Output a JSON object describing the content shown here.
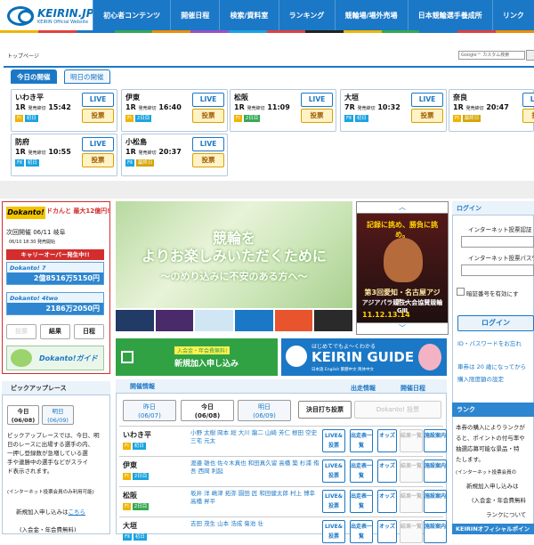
{
  "header": {
    "logo_text": "KEIRIN.JP",
    "logo_sub": "KEIRIN Official Website",
    "nav": [
      "初心者コンテンツ",
      "開催日程",
      "検索/資料室",
      "ランキング",
      "競輪場/場外売場",
      "日本競輪選手養成所",
      "リンク"
    ],
    "stripe_colors": [
      "#f0b400",
      "#e04040",
      "#1b78c6",
      "#33a852",
      "#f08c00",
      "#9b4fc6",
      "#1aa3e0",
      "#e04040",
      "#222222",
      "#f0b400",
      "#33a852",
      "#1b78c6",
      "#e04040",
      "#f08c00"
    ]
  },
  "breadcrumb": "トップページ",
  "search": {
    "placeholder": "Google™ カスタム検索"
  },
  "today_tabs": {
    "today": "今日の開催",
    "tomorrow": "明日の開催"
  },
  "today_cards": [
    {
      "venue": "いわき平",
      "race": "1R",
      "label": "発売締切",
      "time": "15:42",
      "grades": [
        {
          "t": "FⅠ",
          "c": "g1"
        },
        {
          "t": "初日",
          "c": "g2"
        }
      ],
      "live": "LIVE",
      "vote": "投票"
    },
    {
      "venue": "伊東",
      "race": "1R",
      "label": "発売締切",
      "time": "16:40",
      "grades": [
        {
          "t": "FⅠ",
          "c": "g1"
        },
        {
          "t": "2日目",
          "c": "g2"
        }
      ],
      "live": "LIVE",
      "vote": "投票"
    },
    {
      "venue": "松阪",
      "race": "1R",
      "label": "発売締切",
      "time": "11:09",
      "grades": [
        {
          "t": "FⅠ",
          "c": "g1"
        },
        {
          "t": "2日目",
          "c": "g3"
        }
      ],
      "live": "LIVE",
      "vote": "投票"
    },
    {
      "venue": "大垣",
      "race": "7R",
      "label": "発売締切",
      "time": "10:32",
      "grades": [
        {
          "t": "FⅡ",
          "c": "g2"
        },
        {
          "t": "初日",
          "c": "g2"
        }
      ],
      "live": "LIVE",
      "vote": "投票"
    },
    {
      "venue": "奈良",
      "race": "1R",
      "label": "発売締切",
      "time": "20:47",
      "grades": [
        {
          "t": "FⅠ",
          "c": "g1"
        },
        {
          "t": "最終日",
          "c": "g4"
        }
      ],
      "live": "LIVE",
      "vote": "投票"
    },
    {
      "venue": "防府",
      "race": "1R",
      "label": "発売締切",
      "time": "10:55",
      "grades": [
        {
          "t": "FⅡ",
          "c": "g2"
        },
        {
          "t": "初日",
          "c": "g2"
        }
      ],
      "live": "LIVE",
      "vote": "投票"
    },
    {
      "venue": "小松島",
      "race": "1R",
      "label": "発売締切",
      "time": "20:37",
      "grades": [
        {
          "t": "FⅡ",
          "c": "g2"
        },
        {
          "t": "最終日",
          "c": "g4"
        }
      ],
      "live": "LIVE",
      "vote": "投票"
    }
  ],
  "dokanto": {
    "logo": "Dokanto!",
    "logo_sub": "ドカんと 最大12億円!",
    "next_label": "次回開催 06/11 岐阜",
    "date_note": "06/10 18:30 発売開始",
    "carryover": "キャリーオーバー発生中!!",
    "box1_title": "Dokanto! 7",
    "box1_amount": "2億8516万5150円",
    "box2_title": "Dokanto! 4two",
    "box2_amount": "2186万2050円",
    "buttons": [
      "投票",
      "結果",
      "日程"
    ],
    "guide": "Dokanto!ガイド"
  },
  "hero": {
    "line1": "競輪を",
    "line2": "よりお楽しみいただくために",
    "line3": "〜のめり込みに不安のある方へ〜"
  },
  "ad": {
    "top": "記録に挑め、勝負に挑め。",
    "event": "第3回愛知・名古屋アジア・",
    "event2": "アジアパラ競技大会協賛競輪GⅢ",
    "dates": "11.12.13.14",
    "up": "︿",
    "down": "﹀"
  },
  "join": {
    "small": "入会金・年会費無料!",
    "main": "新規加入申し込み"
  },
  "guide": {
    "small": "はじめてでもよ〜くわかる",
    "main": "KEIRIN GUIDE",
    "langs": "日本語  English  繁體中文  简体中文"
  },
  "login": {
    "title": "ログイン",
    "id_label": "インターネット投票認証",
    "pw_label": "インターネット投票パスワ",
    "remember": "暗証番号を有効にす",
    "button": "ログイン",
    "link1": "ID・パスワードをお忘れ",
    "link2": "車券は 20 歳になってから",
    "link3": "購入限度額の設定"
  },
  "ranking": {
    "title": "ランク",
    "text": [
      "本券の購入によりランクが",
      "ると、ポイントの付与率や",
      "抽選応募可能な景品・特",
      "たします。"
    ],
    "note": "(インターネット投票会員の",
    "join": "新規加入申し込みは",
    "fee": "(入会金・年会費無料",
    "more": "ランクについて",
    "official": "KEIRINオフィシャルポイン"
  },
  "pickup": {
    "title": "ピックアップレース",
    "tab_today": "今日",
    "tab_today_date": "(06/08)",
    "tab_tom": "明日",
    "tab_tom_date": "(06/09)",
    "lines": [
      "ピックアップレースでは、今日、明",
      "日のレースに出場する選手の内、",
      "一押し登録数が急増している選",
      "手や連勝中の選手などがスライ",
      "ド表示されます。"
    ],
    "note": "(インターネット投票会員のみ利用可能)",
    "join": "新規加入申し込みは",
    "join_link": "こちら",
    "fee": "(入会金・年会費無料)"
  },
  "races": {
    "title": "開催情報",
    "shussou": "出走情報",
    "kaisai": "開催日程",
    "tabs": [
      {
        "l": "昨日",
        "d": "(06/07)"
      },
      {
        "l": "今日",
        "d": "(06/08)"
      },
      {
        "l": "明日",
        "d": "(06/09)"
      }
    ],
    "kettei": "決目打ち投票",
    "dk_vote": "Dokanto! 投票",
    "rows": [
      {
        "venue": "いわき平",
        "grades": [
          {
            "t": "FⅠ",
            "c": "g1"
          },
          {
            "t": "初日",
            "c": "g2"
          }
        ],
        "players": "小野 太樹 岡本 総 大川 龍二 山崎 芳仁 根田 空史 三宅 元太"
      },
      {
        "venue": "伊東",
        "grades": [
          {
            "t": "FⅠ",
            "c": "g1"
          },
          {
            "t": "2日目",
            "c": "g2"
          }
        ],
        "players": "渡邉 雄也 佐々木真也 和田真久留 高橋 築 杉浦 侑吾 西岡 利起"
      },
      {
        "venue": "松阪",
        "grades": [
          {
            "t": "FⅠ",
            "c": "g1"
          },
          {
            "t": "2日目",
            "c": "g3"
          }
        ],
        "players": "坂井 洋 嶋津 拓弥 園田 匠 和田健太郎 村上 博幸 高橋 昇平"
      },
      {
        "venue": "大垣",
        "grades": [
          {
            "t": "FⅡ",
            "c": "g2"
          },
          {
            "t": "初日",
            "c": "g2"
          }
        ],
        "players": "吉田 茂生 山本 浩成 菊池 壮"
      }
    ],
    "btn_live": "LIVE&投票",
    "btn_entry": "出走表一覧",
    "btn_odds": "オッズ",
    "btn_result": "結果一覧",
    "btn_info": "施設案内"
  }
}
